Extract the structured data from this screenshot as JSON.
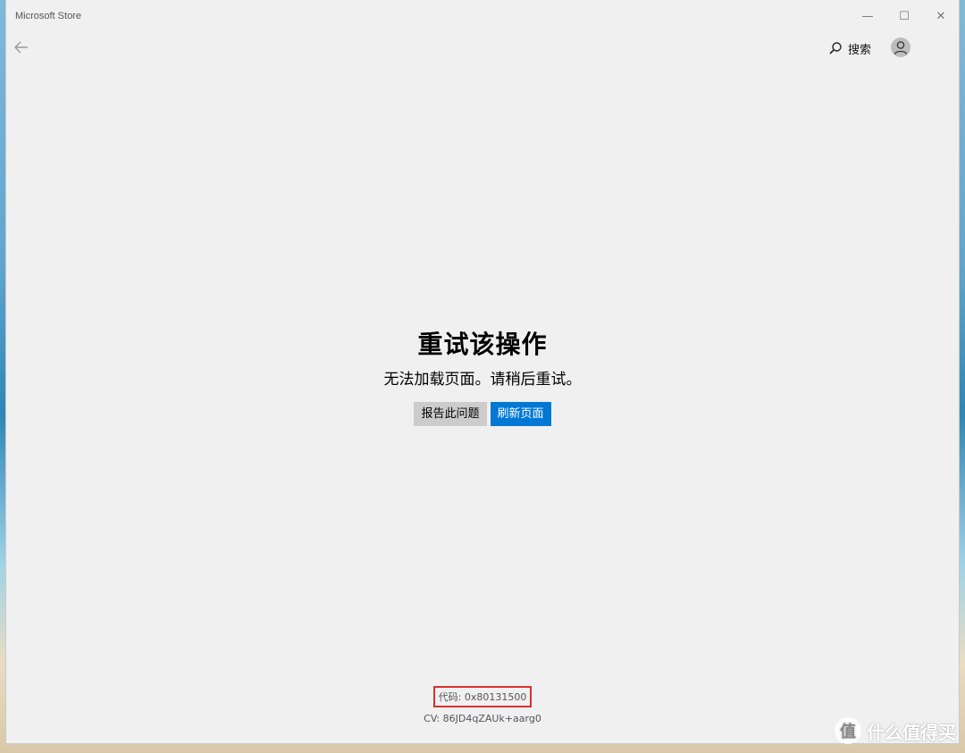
{
  "window": {
    "title": "Microsoft Store",
    "controls": {
      "minimize": "—",
      "maximize": "☐",
      "close": "✕"
    }
  },
  "header": {
    "search_label": "搜索"
  },
  "error": {
    "heading": "重试该操作",
    "message": "无法加载页面。请稍后重试。",
    "report_button": "报告此问题",
    "refresh_button": "刷新页面",
    "code": "代码: 0x80131500",
    "cv": "CV: 86JD4qZAUk+aarg0"
  },
  "watermark": {
    "text": "什么值得买",
    "logo_glyph": "值"
  },
  "colors": {
    "accent": "#0078d4",
    "highlight_border": "#d9302c"
  }
}
